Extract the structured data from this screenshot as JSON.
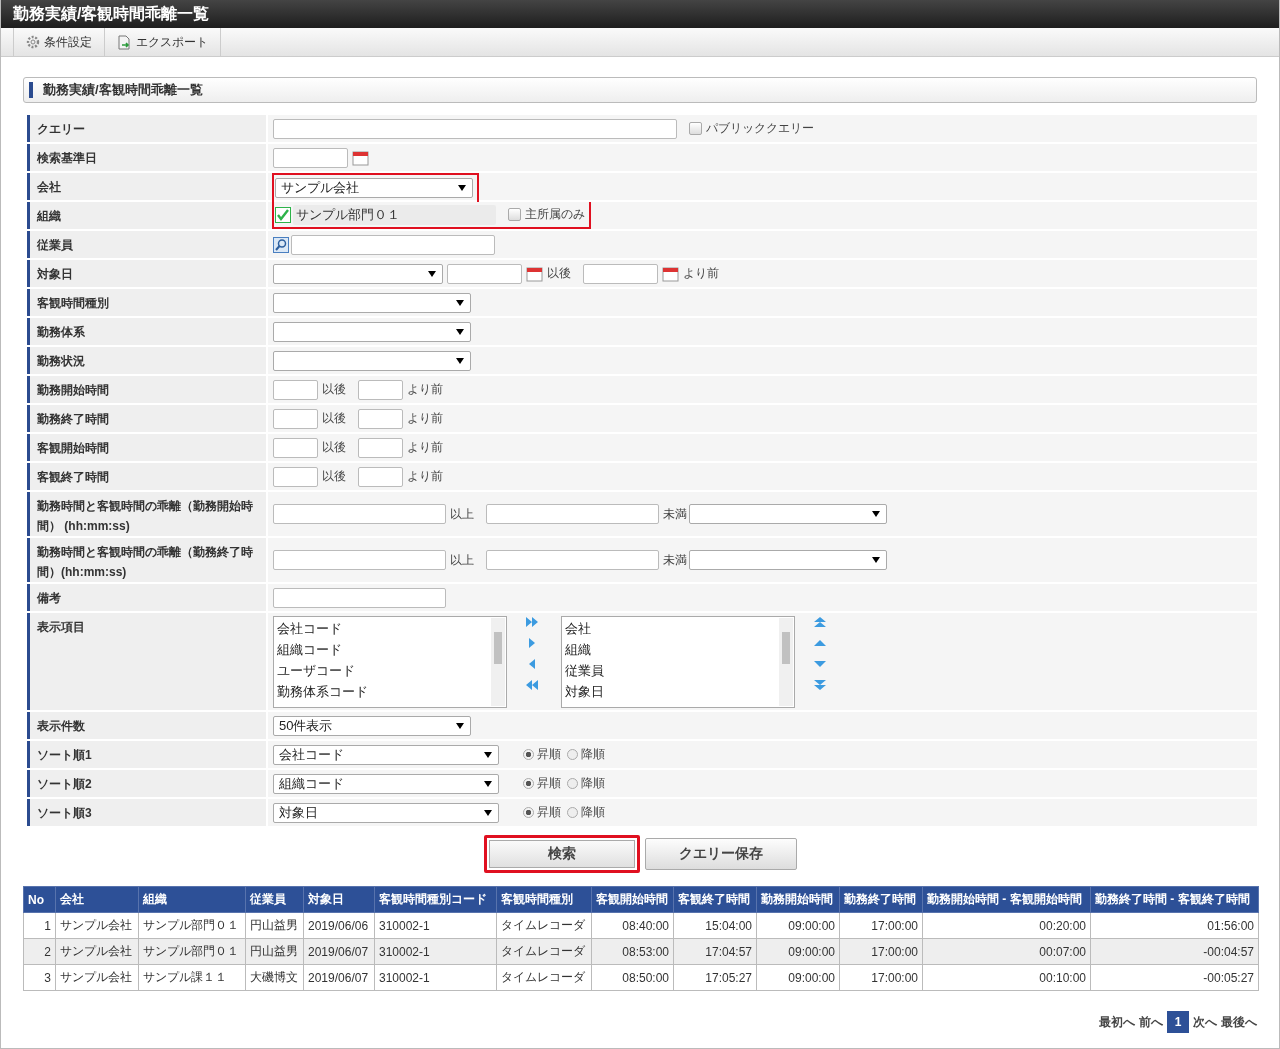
{
  "window": {
    "title": "勤務実績/客観時間乖離一覧"
  },
  "toolbar": [
    {
      "label": "条件設定",
      "kind": "settings"
    },
    {
      "label": "エクスポート",
      "kind": "export"
    }
  ],
  "section_title": "勤務実績/客観時間乖離一覧",
  "form": {
    "rows": [
      {
        "label": "クエリー",
        "kind": "query",
        "checkbox": {
          "label": "パブリッククエリー",
          "checked": false
        }
      },
      {
        "label": "検索基準日",
        "kind": "date"
      },
      {
        "label": "会社",
        "kind": "select",
        "value": "サンプル会社",
        "highlighted": true
      },
      {
        "label": "組織",
        "kind": "org",
        "checked": true,
        "value": "サンプル部門０１",
        "option": {
          "label": "主所属のみ",
          "checked": false
        },
        "highlighted": true
      },
      {
        "label": "従業員",
        "kind": "lookup"
      },
      {
        "label": "対象日",
        "kind": "date_range",
        "after": "以後",
        "before": "より前"
      },
      {
        "label": "客観時間種別",
        "kind": "select"
      },
      {
        "label": "勤務体系",
        "kind": "select"
      },
      {
        "label": "勤務状況",
        "kind": "select"
      },
      {
        "label": "勤務開始時間",
        "kind": "time_range",
        "after": "以後",
        "before": "より前"
      },
      {
        "label": "勤務終了時間",
        "kind": "time_range",
        "after": "以後",
        "before": "より前"
      },
      {
        "label": "客観開始時間",
        "kind": "time_range",
        "after": "以後",
        "before": "より前"
      },
      {
        "label": "客観終了時間",
        "kind": "time_range",
        "after": "以後",
        "before": "より前"
      },
      {
        "label": "勤務時間と客観時間の乖離（勤務開始時間） (hh:mm:ss)",
        "kind": "diff_range",
        "min": "以上",
        "max": "未満"
      },
      {
        "label": "勤務時間と客観時間の乖離（勤務終了時間）(hh:mm:ss)",
        "kind": "diff_range",
        "min": "以上",
        "max": "未満"
      },
      {
        "label": "備考",
        "kind": "text"
      },
      {
        "label": "表示項目",
        "kind": "columns",
        "available": [
          "会社コード",
          "組織コード",
          "ユーザコード",
          "勤務体系コード"
        ],
        "chosen": [
          "会社",
          "組織",
          "従業員",
          "対象日"
        ]
      },
      {
        "label": "表示件数",
        "kind": "count",
        "value": "50件表示"
      },
      {
        "label": "ソート順1",
        "kind": "sort",
        "value": "会社コード",
        "radios": [
          {
            "label": "昇順",
            "selected": true
          },
          {
            "label": "降順",
            "selected": false
          }
        ]
      },
      {
        "label": "ソート順2",
        "kind": "sort",
        "value": "組織コード",
        "radios": [
          {
            "label": "昇順",
            "selected": true
          },
          {
            "label": "降順",
            "selected": false
          }
        ]
      },
      {
        "label": "ソート順3",
        "kind": "sort",
        "value": "対象日",
        "radios": [
          {
            "label": "昇順",
            "selected": true
          },
          {
            "label": "降順",
            "selected": false
          }
        ]
      }
    ]
  },
  "buttons": [
    {
      "label": "検索",
      "highlighted": true
    },
    {
      "label": "クエリー保存",
      "highlighted": false
    }
  ],
  "table": {
    "columns": [
      "No",
      "会社",
      "組織",
      "従業員",
      "対象日",
      "客観時間種別コード",
      "客観時間種別",
      "客観開始時間",
      "客観終了時間",
      "勤務開始時間",
      "勤務終了時間",
      "勤務開始時間 - 客観開始時間",
      "勤務終了時間 - 客観終了時間"
    ],
    "rows": [
      [
        "1",
        "サンプル会社",
        "サンプル部門０１",
        "円山益男",
        "2019/06/06",
        "310002-1",
        "タイムレコーダ",
        "08:40:00",
        "15:04:00",
        "09:00:00",
        "17:00:00",
        "00:20:00",
        "01:56:00"
      ],
      [
        "2",
        "サンプル会社",
        "サンプル部門０１",
        "円山益男",
        "2019/06/07",
        "310002-1",
        "タイムレコーダ",
        "08:53:00",
        "17:04:57",
        "09:00:00",
        "17:00:00",
        "00:07:00",
        "-00:04:57"
      ],
      [
        "3",
        "サンプル会社",
        "サンプル課１１",
        "大磯博文",
        "2019/06/07",
        "310002-1",
        "タイムレコーダ",
        "08:50:00",
        "17:05:27",
        "09:00:00",
        "17:00:00",
        "00:10:00",
        "-00:05:27"
      ]
    ]
  },
  "pagination": {
    "first": "最初へ",
    "prev": "前へ",
    "pages": [
      {
        "label": "1",
        "selected": true
      }
    ],
    "next": "次へ",
    "last": "最後へ"
  }
}
